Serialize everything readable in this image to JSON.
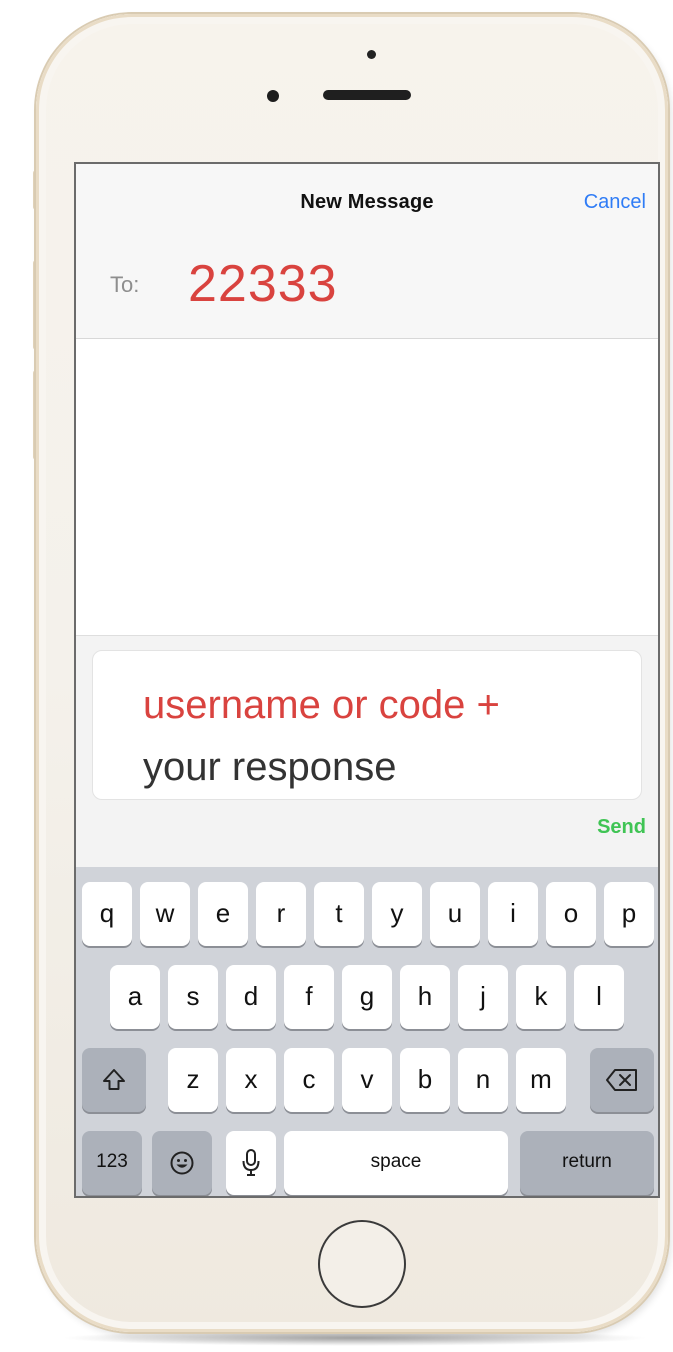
{
  "nav": {
    "title": "New Message",
    "cancel_label": "Cancel"
  },
  "recipient": {
    "label": "To:",
    "value": "22333"
  },
  "compose": {
    "line1": "username or code +",
    "line2": "your response",
    "send_label": "Send"
  },
  "keyboard": {
    "row1": [
      "q",
      "w",
      "e",
      "r",
      "t",
      "y",
      "u",
      "i",
      "o",
      "p"
    ],
    "row2": [
      "a",
      "s",
      "d",
      "f",
      "g",
      "h",
      "j",
      "k",
      "l"
    ],
    "row3": [
      "z",
      "x",
      "c",
      "v",
      "b",
      "n",
      "m"
    ],
    "shift_icon": "shift-icon",
    "delete_icon": "delete-icon",
    "numbers_label": "123",
    "emoji_icon": "emoji-icon",
    "mic_icon": "microphone-icon",
    "space_label": "space",
    "return_label": "return"
  },
  "colors": {
    "accent_red": "#d9433f",
    "link_blue": "#2f7cf6",
    "send_green": "#3fc454",
    "keyboard_bg": "#d0d3d9",
    "phone_gold": "#e9dcc6"
  }
}
